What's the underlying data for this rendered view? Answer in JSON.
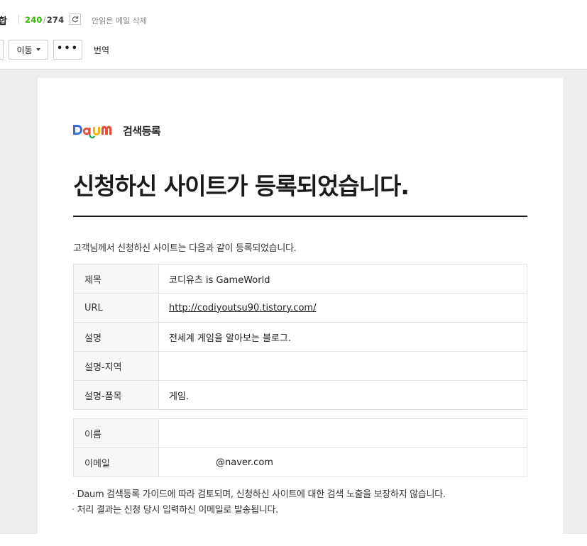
{
  "toolbar": {
    "folder_title": "합",
    "unread_count": "240",
    "total_count": "274",
    "delete_unread_label": "안읽은 메일 삭제",
    "move_label": "이동",
    "more_label": "•••",
    "translate_label": "번역"
  },
  "mail": {
    "logo_text": "검색등록",
    "headline": "신청하신 사이트가 등록되었습니다.",
    "intro": "고객님께서 신청하신 사이트는 다음과 같이 등록되었습니다.",
    "site_rows": [
      {
        "label": "제목",
        "value": "코디유츠 is GameWorld"
      },
      {
        "label": "URL",
        "value": "http://codiyoutsu90.tistory.com/"
      },
      {
        "label": "설명",
        "value": "전세계 게임을 알아보는 블로그."
      },
      {
        "label": "설명-지역",
        "value": ""
      },
      {
        "label": "설명-품목",
        "value": "게임."
      }
    ],
    "user_rows": [
      {
        "label": "이름",
        "value": ""
      },
      {
        "label": "이메일",
        "value": "@naver.com"
      }
    ],
    "notes": [
      "Daum 검색등록 가이드에 따라 검토되며, 신청하신 사이트에 대한 검색 노출을 보장하지 않습니다.",
      "처리 결과는 신청 당시 입력하신 이메일로 발송됩니다."
    ]
  },
  "colors": {
    "unread": "#2db400",
    "viewer_bg": "#ededed",
    "logo_blue": "#3b6fd8",
    "logo_red": "#e84c3d",
    "logo_yellow": "#f2b600",
    "logo_green": "#34a853"
  },
  "icons": {
    "refresh": "refresh-icon",
    "caret": "chevron-down-icon",
    "logo": "daum-logo"
  }
}
